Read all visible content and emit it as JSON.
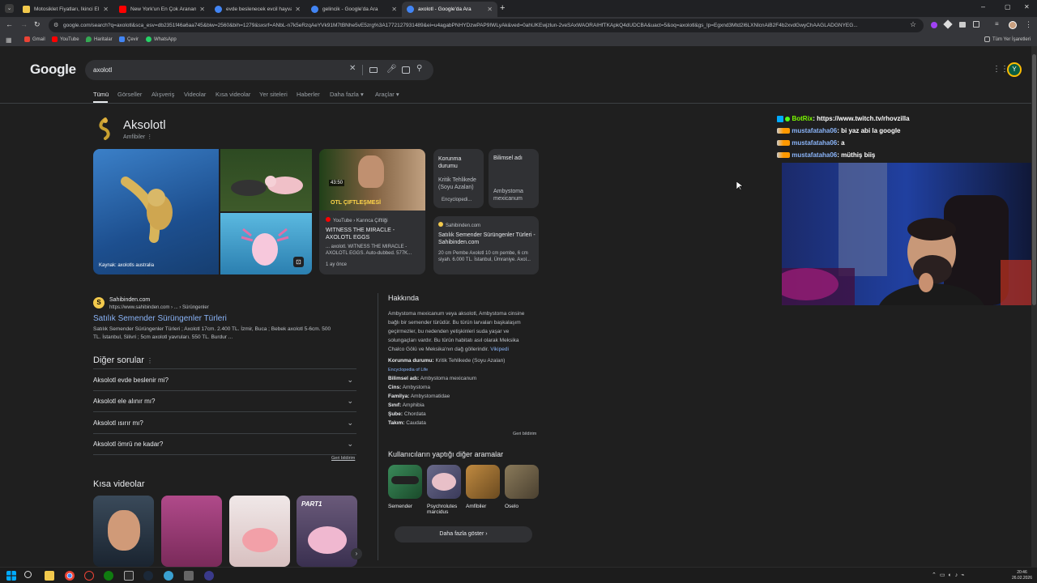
{
  "browser": {
    "tabs": [
      {
        "title": "Motosiklet Fiyatları, İkinci El ve",
        "fav": "#f2c94c"
      },
      {
        "title": "New York'un En Çok Aranan Sa",
        "fav": "#ff0000"
      },
      {
        "title": "evde beslenecek evcil hayvanla",
        "fav": "#4285f4"
      },
      {
        "title": "gelincik - Google'da Ara",
        "fav": "#4285f4"
      },
      {
        "title": "axolotl - Google'da Ara",
        "fav": "#4285f4"
      }
    ],
    "url": "google.com/search?q=axolotl&sca_esv=db2351f46a6aa745&biw=2560&bih=1279&sxsrf=ANbL-n7k5eRzqAeYVk91M7tBNhe5vE5zrg%3A1772127931489&ei=u4agabPNHYDzwPAP9IWLyAk&ved=0ahUKEwjzlun-2veSAxWAORAIHfTKApkQ4dUDCBA&uact=5&oq=axolotl&gs_lp=Egxnd3Mtd2l6LXNlcnAiB2F4b2xvdGwyChAAGLADGNYEG...",
    "bookmarks": [
      "Gmail",
      "YouTube",
      "Haritalar",
      "Çevir",
      "WhatsApp"
    ],
    "all_bookmarks": "Tüm Yer İşaretleri"
  },
  "google": {
    "logo": "Google",
    "query": "axolotl",
    "nav": [
      "Tümü",
      "Görseller",
      "Alışveriş",
      "Videolar",
      "Kısa videolar",
      "Yer siteleri",
      "Haberler",
      "Daha fazla",
      "Araçlar"
    ],
    "kp_title": "Aksolotl",
    "kp_subtitle": "Amfibiler",
    "img_caption": "Kaynak: axolotls australia",
    "yt_card": {
      "source": "YouTube › Karınca Çiftliği",
      "title": "WITNESS THE MIRACLE - AXOLOTL EGGS",
      "snippet": "... axolotl. WITNESS THE MIRACLE - AXOLOTL EGGS. Auto-dubbed. 577K...",
      "age": "1 ay önce",
      "duration": "43:50",
      "thumb_text": "OTL ÇIFTLEŞMESİ"
    },
    "info_card1": {
      "label": "Korunma durumu",
      "value": "Kritik Tehlikede (Soyu Azalan)",
      "source": "Encyclopedi..."
    },
    "info_card2": {
      "label": "Bilimsel adı",
      "value": "Ambystoma mexicanum"
    },
    "sahibinden_card": {
      "source": "Sahibinden.com",
      "title": "Satılık Semender Sürüngenler Türleri - Sahibinden.com",
      "snippet": "20 cm Pembe Axolotl 10 cm pembe, 6 cm siyah. 6.000 TL. İstanbul, Ümraniye. Axol..."
    },
    "result": {
      "site": "Sahibinden.com",
      "url": "https://www.sahibinden.com › ... › Sürüngenler",
      "title": "Satılık Semender Sürüngenler Türleri",
      "snippet1": "Satılık Semender Sürüngenler Türleri ; Axolotl 17cm. 2.400 TL. İzmir, Buca ; Bebek axolotl 5-6cm. 500",
      "snippet2": "TL. İstanbul, Silivri ; 5cm axolotl yavruları. 550 TL. Burdur ..."
    },
    "faq_title": "Diğer sorular",
    "faqs": [
      "Aksolotl evde beslenir mi?",
      "Aksolotl ele alınır mı?",
      "Aksolotl ısırır mı?",
      "Aksolotl ömrü ne kadar?"
    ],
    "feedback": "Geri bildirim",
    "short_videos_title": "Kısa videolar",
    "about": {
      "title": "Hakkında",
      "text": [
        "Ambystoma mexicanum veya aksolotl, Ambystoma cinsine",
        "bağlı bir semender türüdür. Bu türün larvaları başkalaşım",
        "geçirmezler, bu nedenden yetişkinleri suda yaşar ve",
        "solungaçları vardır. Bu türün habitatı asıl olarak Meksika",
        "Chalco Gölü ve Meksika'nın dağ göllerindir."
      ],
      "wiki": "Vikipedi",
      "facts": [
        {
          "k": "Korunma durumu:",
          "v": "Kritik Tehlikede (Soyu Azalan)"
        },
        {
          "k": "Bilimsel adı:",
          "v": "Ambystoma mexicanum"
        },
        {
          "k": "Cins:",
          "v": "Ambystoma"
        },
        {
          "k": "Familya:",
          "v": "Ambystomatidae"
        },
        {
          "k": "Sınıf:",
          "v": "Amphibia"
        },
        {
          "k": "Şube:",
          "v": "Chordata"
        },
        {
          "k": "Takım:",
          "v": "Caudata"
        }
      ],
      "eol": "Encyclopedia of Life"
    },
    "people_title": "Kullanıcıların yaptığı diğer aramalar",
    "people": [
      "Semender",
      "Psychrolutes marcidus",
      "Amfibiler",
      "Oselo"
    ],
    "more_button": "Daha fazla göster",
    "avatar": "Y",
    "part_label": "PART1"
  },
  "chat": [
    {
      "user": "BotRix",
      "msg": ": https://www.twitch.tv/rhovzilla",
      "color": "#7cfc00"
    },
    {
      "user": "mustafataha06",
      "msg": ": bi yaz abi la google",
      "color": "#8ab4f8"
    },
    {
      "user": "mustafataha06",
      "msg": ": a",
      "color": "#8ab4f8"
    },
    {
      "user": "mustafataha06",
      "msg": ": müthiş biiş",
      "color": "#8ab4f8"
    }
  ],
  "tray": {
    "time": "20:46",
    "date": "26.02.2026"
  }
}
